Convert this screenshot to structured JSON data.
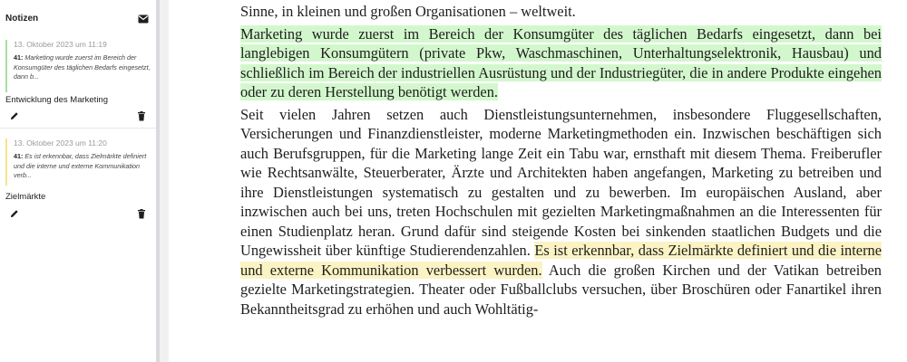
{
  "sidebar": {
    "title": "Notizen",
    "notes": [
      {
        "date": "13. Oktober 2023 um 11:19",
        "page": "41:",
        "quote": "Marketing wurde zuerst im Bereich der Konsumgüter des täglichen Bedarfs eingesetzt, dann b...",
        "title": "Entwicklung des Marketing",
        "color": "#a8e0a0"
      },
      {
        "date": "13. Oktober 2023 um 11:20",
        "page": "41:",
        "quote": "Es ist erkennbar, dass Zielmärkte definiert und die interne und externe Kommunikation verb...",
        "title": "Zielmärkte",
        "color": "#f5e58a"
      }
    ],
    "icons": {
      "mail": "envelope-icon",
      "edit": "pencil-icon",
      "delete": "trash-icon"
    }
  },
  "document": {
    "top_line": "Sinne, in kleinen und großen Organisationen – weltweit.",
    "highlight_green": "Marketing wurde zuerst im Bereich der Konsumgüter des täglichen Bedarfs eingesetzt, dann bei langlebigen Konsumgütern (private Pkw, Waschmaschinen, Unterhaltungselektronik, Hausbau) und schließlich im Bereich der industriellen Ausrüstung und der Industriegüter, die in andere Produkte eingehen oder zu deren Herstellung benötigt werden.",
    "para2_before": "Seit vielen Jahren setzen auch Dienstleistungsunternehmen, insbesondere Fluggesellschaf­ten, Versicherungen und Finanzdienstleister, moderne Marketingmethoden ein. Inzwischen beschäftigen sich auch Berufsgruppen, für die Marketing lange Zeit ein Tabu war, ernsthaft mit diesem Thema. Freiberufler wie Rechtsanwälte, Steuerberater, Ärzte und Architekten haben angefangen, Marketing zu betreiben und ihre Dienstleistungen systematisch zu gestal­ten und zu bewerben. Im europäischen Ausland, aber inzwischen auch bei uns, treten Hoch­schulen mit gezielten Marketingmaßnahmen an die Interessenten für einen Studienplatz heran. Grund dafür sind steigende Kosten bei sinkenden staatlichen Budgets und die Unge­wissheit über künftige Studierendenzahlen. ",
    "highlight_yellow": "Es ist erkennbar, dass Zielmärkte definiert und die interne und externe Kommunikation verbessert wurden.",
    "para2_after": " Auch die großen Kirchen und der Vatikan betreiben gezielte Marketingstrategien. Theater oder Fußballclubs versuchen, über Broschüren oder Fanartikel ihren Bekanntheitsgrad zu erhöhen und auch Wohltätig-",
    "colors": {
      "green_highlight": "#d3f7cd",
      "yellow_highlight": "#fbf3c4"
    }
  }
}
